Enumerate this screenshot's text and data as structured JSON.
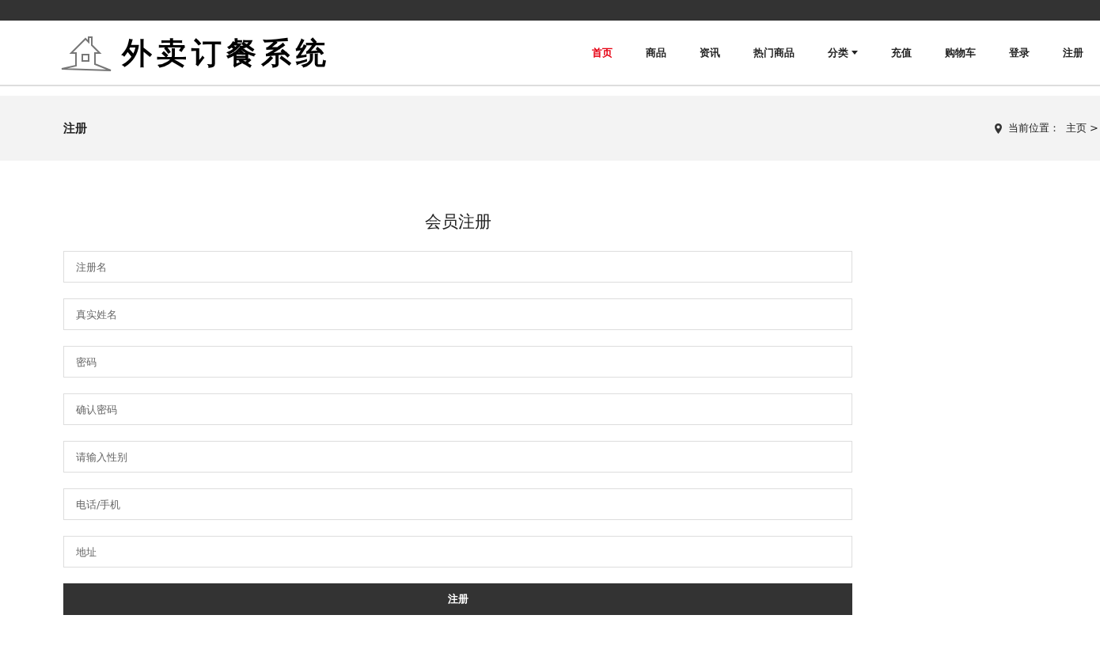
{
  "logo": {
    "title": "外卖订餐系统"
  },
  "nav": [
    {
      "label": "首页",
      "selected": true,
      "kind": "link"
    },
    {
      "label": "商品",
      "selected": false,
      "kind": "link"
    },
    {
      "label": "资讯",
      "selected": false,
      "kind": "link"
    },
    {
      "label": "热门商品",
      "selected": false,
      "kind": "link"
    },
    {
      "label": "分类",
      "selected": false,
      "kind": "dropdown"
    },
    {
      "label": "充值",
      "selected": false,
      "kind": "link"
    },
    {
      "label": "购物车",
      "selected": false,
      "kind": "link"
    },
    {
      "label": "登录",
      "selected": false,
      "kind": "link"
    },
    {
      "label": "注册",
      "selected": false,
      "kind": "link"
    }
  ],
  "page_header": {
    "title": "注册",
    "location_label": "当前位置：",
    "breadcrumb": "主页 >"
  },
  "form": {
    "title": "会员注册",
    "fields": [
      {
        "placeholder": "注册名"
      },
      {
        "placeholder": "真实姓名"
      },
      {
        "placeholder": "密码"
      },
      {
        "placeholder": "确认密码"
      },
      {
        "placeholder": "请输入性别"
      },
      {
        "placeholder": "电话/手机"
      },
      {
        "placeholder": "地址"
      }
    ],
    "submit": "注册"
  }
}
